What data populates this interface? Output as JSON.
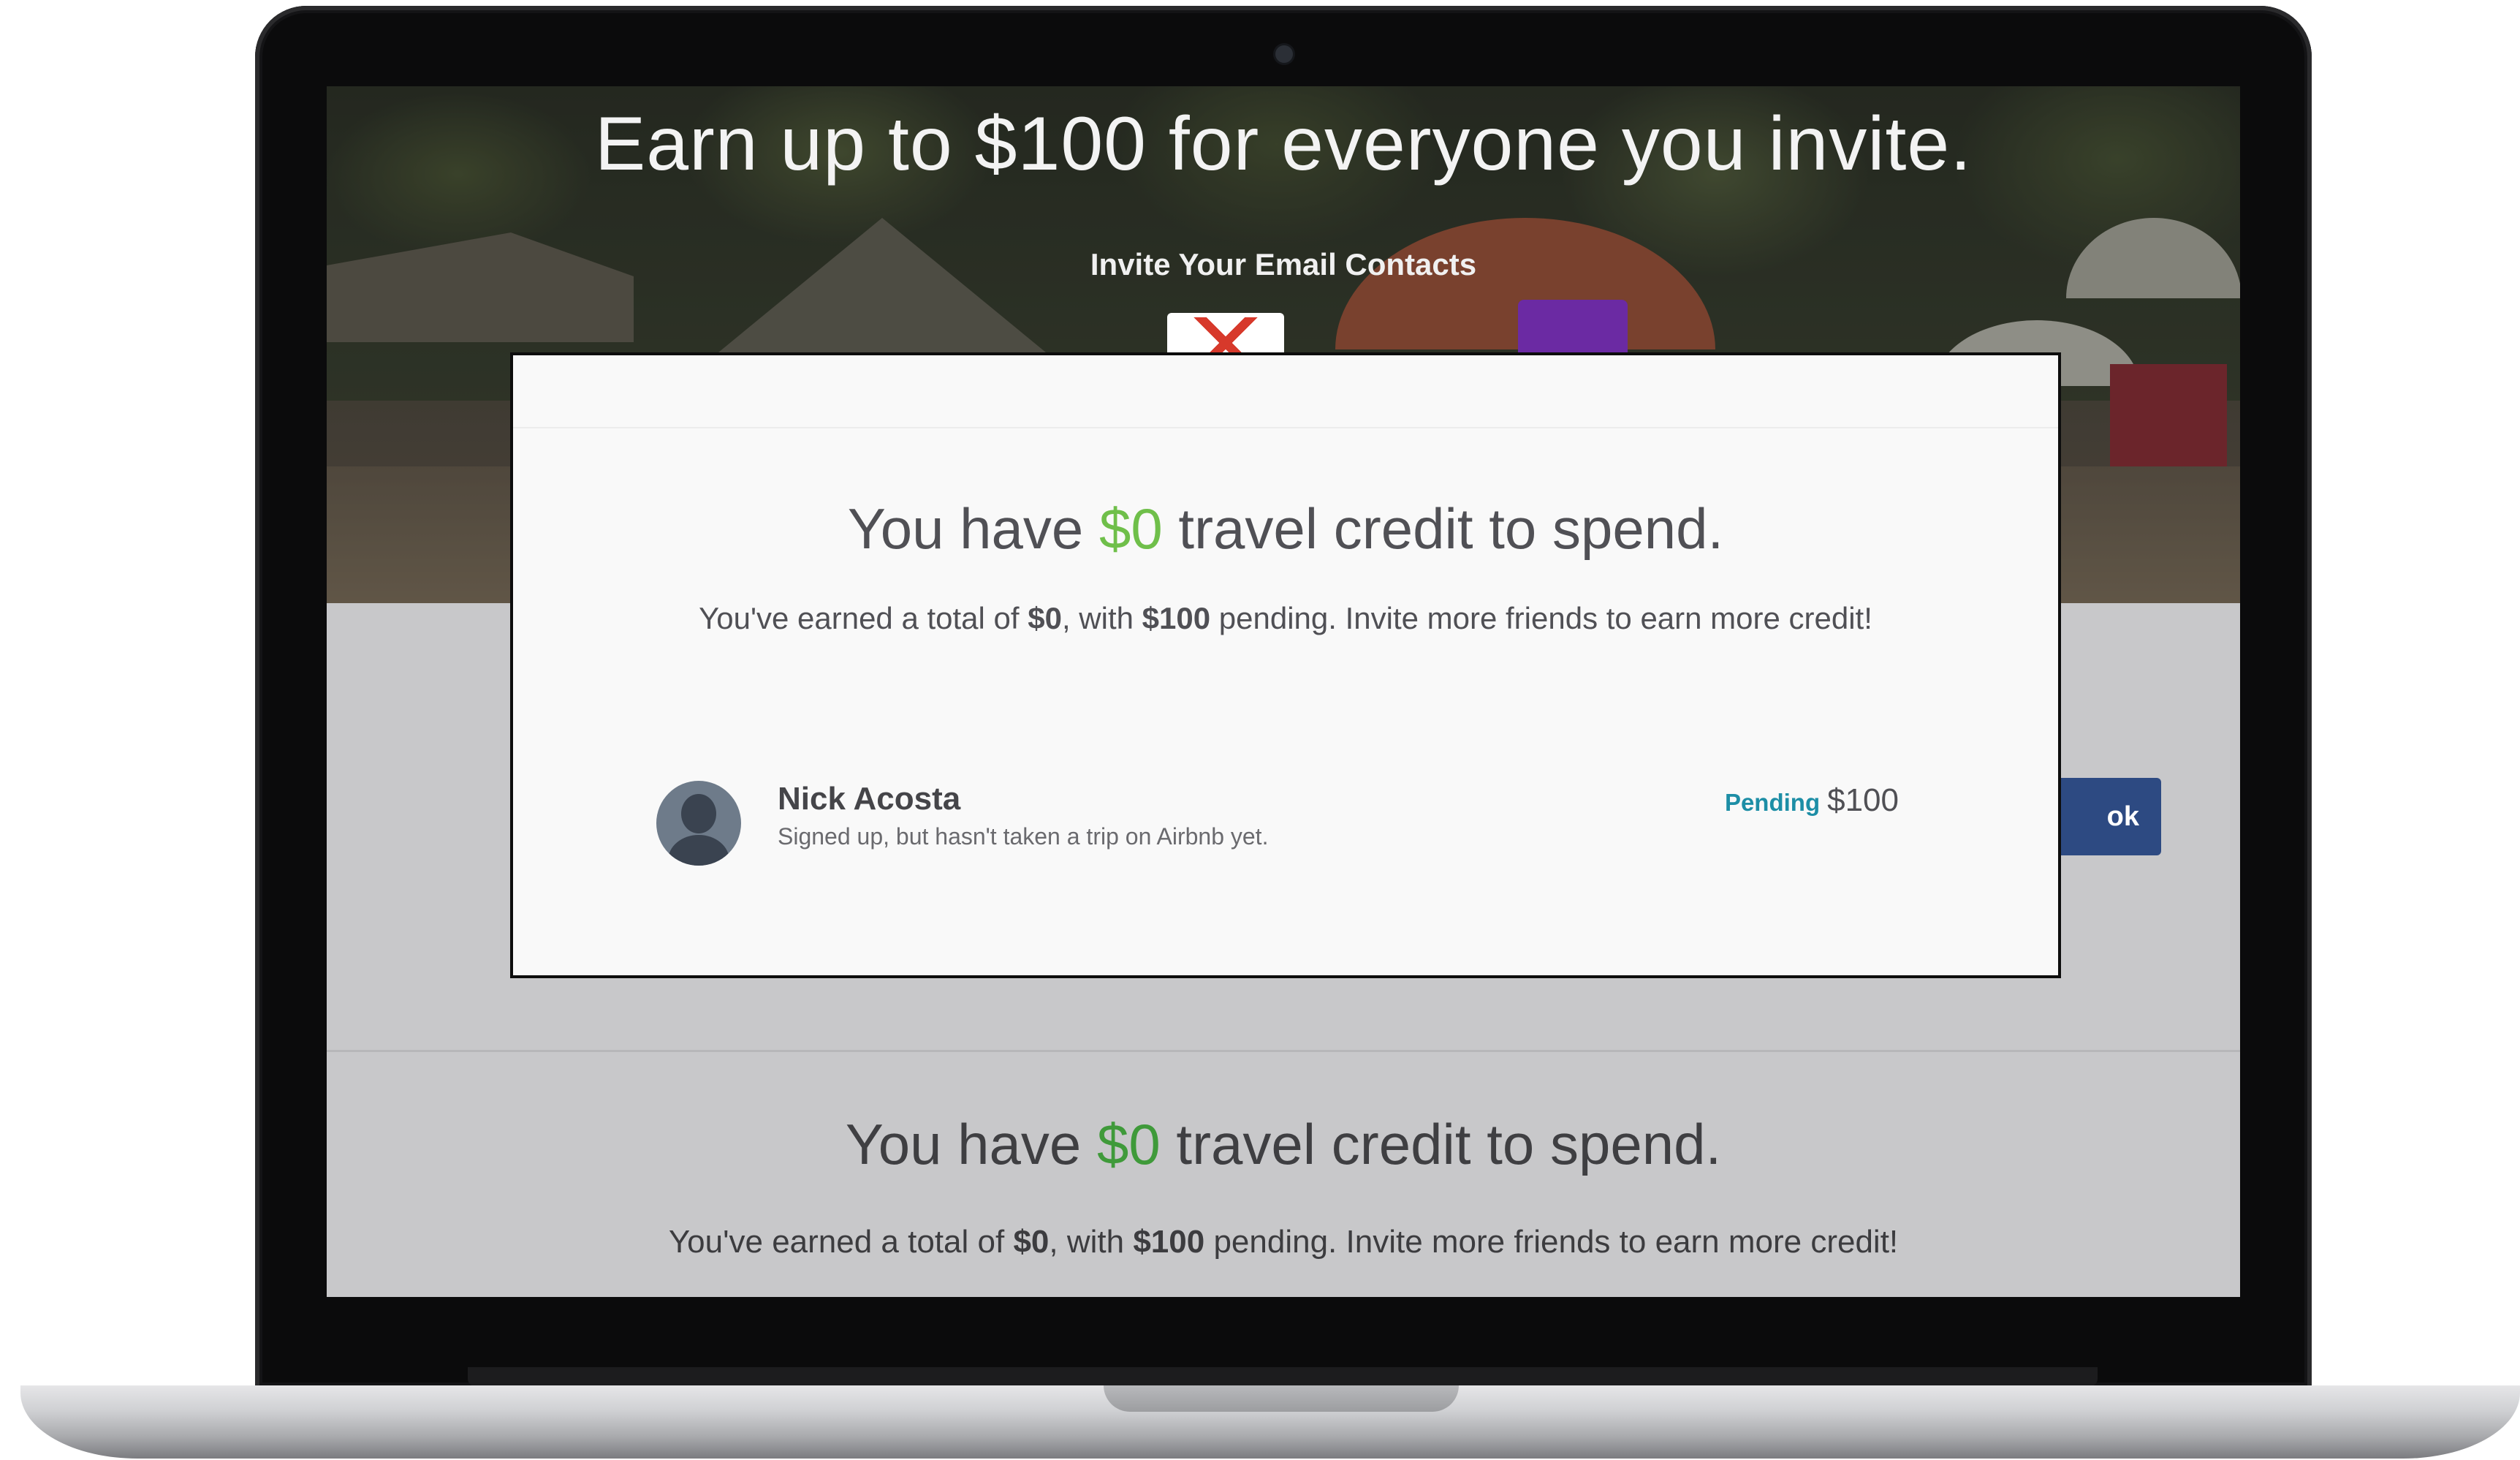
{
  "hero": {
    "title": "Earn up to $100 for everyone you invite.",
    "subtitle": "Invite Your Email Contacts",
    "providers": [
      "gmail-icon",
      "yahoo-icon"
    ]
  },
  "modal": {
    "title_pre": "You have ",
    "title_amount": "$0",
    "title_post": " travel credit to spend.",
    "sub_pre": "You've earned a total of ",
    "sub_earned": "$0",
    "sub_mid": ", with ",
    "sub_pending": "$100",
    "sub_post": " pending. Invite more friends to earn more credit!",
    "friends": [
      {
        "name": "Nick Acosta",
        "status": "Signed up, but hasn't taken a trip on Airbnb yet.",
        "badge": "Pending",
        "amount": "$100"
      }
    ]
  },
  "background": {
    "facebook_button_label": "ok",
    "credit_title_pre": "You have ",
    "credit_title_amount": "$0",
    "credit_title_post": " travel credit to spend.",
    "credit_sub_pre": "You've earned a total of ",
    "credit_sub_earned": "$0",
    "credit_sub_mid": ", with ",
    "credit_sub_pending": "$100",
    "credit_sub_post": " pending. Invite more friends to earn more credit!"
  },
  "colors": {
    "credit_green": "#6fbf4a",
    "pending_blue": "#1d8ea6",
    "facebook_blue": "#2d4a82"
  }
}
